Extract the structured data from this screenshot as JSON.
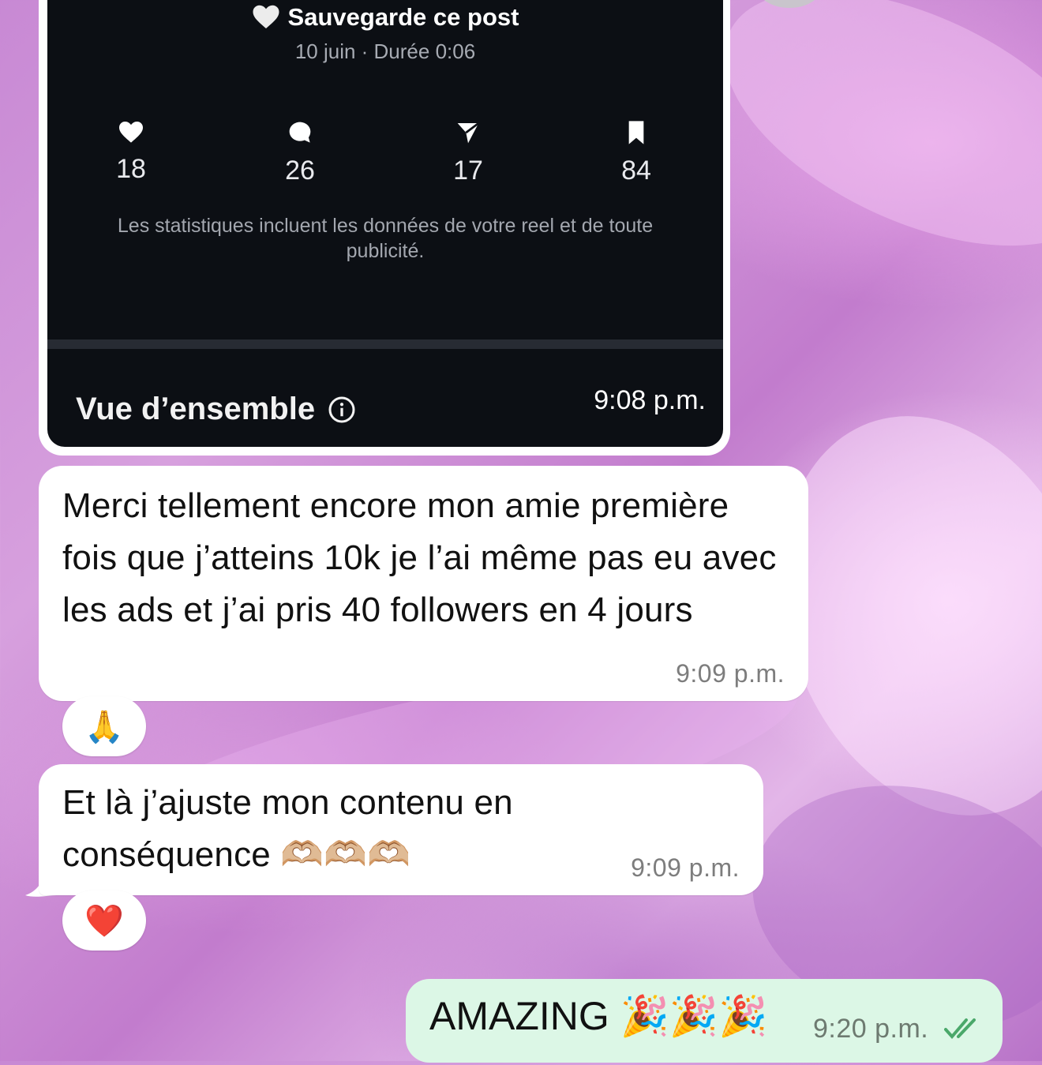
{
  "shared_post": {
    "title": "Sauvegarde ce post",
    "subtitle": "10 juin · Durée 0:06",
    "stats": [
      {
        "icon": "heart-icon",
        "value": "18"
      },
      {
        "icon": "comment-icon",
        "value": "26"
      },
      {
        "icon": "share-icon",
        "value": "17"
      },
      {
        "icon": "bookmark-icon",
        "value": "84"
      }
    ],
    "note": "Les statistiques incluent les données de votre reel et de toute publicité.",
    "overview_label": "Vue d’ensemble",
    "time": "9:08 p.m."
  },
  "messages": [
    {
      "text": "Merci tellement encore mon amie première fois que j’atteins 10k je l’ai même pas eu avec les ads et j’ai pris 40 followers en 4 jours",
      "time": "9:09 p.m.",
      "reaction": "🙏"
    },
    {
      "text": "Et là j’ajuste mon contenu en conséquence 🫶🏼🫶🏼🫶🏼",
      "time": "9:09 p.m.",
      "reaction": "❤️"
    }
  ],
  "sent_message": {
    "text": "AMAZING 🎉🎉🎉",
    "time": "9:20 p.m.",
    "status": "read-double-check-icon",
    "check_color": "#4aa86a"
  },
  "colors": {
    "bubble_in": "#ffffff",
    "bubble_out": "#dcf7e6",
    "card_bg": "#0c0f14"
  }
}
